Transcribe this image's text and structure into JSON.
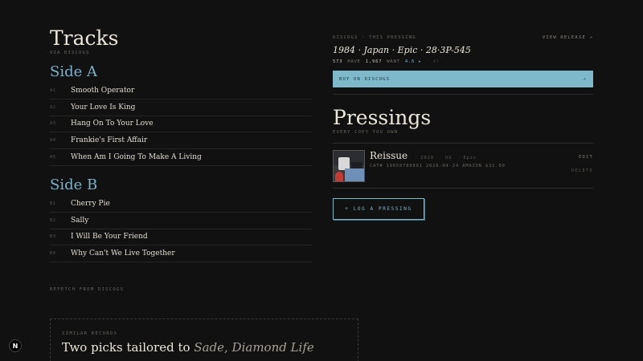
{
  "tracks": {
    "title": "Tracks",
    "source": "VIA DISCOGS",
    "side_a": {
      "title": "Side A",
      "items": [
        {
          "num": "A1",
          "name": "Smooth Operator"
        },
        {
          "num": "A2",
          "name": "Your Love Is King"
        },
        {
          "num": "A3",
          "name": "Hang On To Your Love"
        },
        {
          "num": "A4",
          "name": "Frankie's First Affair"
        },
        {
          "num": "A5",
          "name": "When Am I Going To Make A Living"
        }
      ]
    },
    "side_b": {
      "title": "Side B",
      "items": [
        {
          "num": "B1",
          "name": "Cherry Pie"
        },
        {
          "num": "B2",
          "name": "Sally"
        },
        {
          "num": "B3",
          "name": "I Will Be Your Friend"
        },
        {
          "num": "B4",
          "name": "Why Can't We Live Together"
        }
      ]
    },
    "refetch_label": "REFETCH FROM DISCOGS"
  },
  "discogs": {
    "label": "DISCOGS · THIS PRESSING",
    "view_release": "VIEW RELEASE ↗",
    "pressing": "1984 · Japan · Epic · 28·3P-545",
    "have_count": "573",
    "have_label": "HAVE",
    "want_count": "1,967",
    "want_label": "WANT",
    "rating": "4.6 ★",
    "rating_count": "· 47",
    "buy_label": "BUY ON DISCOGS",
    "buy_arrow": "↗"
  },
  "pressings": {
    "title": "Pressings",
    "subtitle": "EVERY COPY YOU OWN",
    "items": [
      {
        "name": "Reissue",
        "year": "2020",
        "country": "US",
        "label": "Epic",
        "details": "CAT# 19658780801  2026-04-24  AMAZON  $32.00",
        "edit": "EDIT",
        "delete": "DELETE"
      }
    ],
    "log_label": "+ LOG A PRESSING"
  },
  "similar": {
    "label": "SIMILAR RECORDS",
    "title_prefix": "Two picks tailored to ",
    "title_highlight": "Sade, Diamond Life"
  },
  "badge": {
    "letter": "N"
  }
}
